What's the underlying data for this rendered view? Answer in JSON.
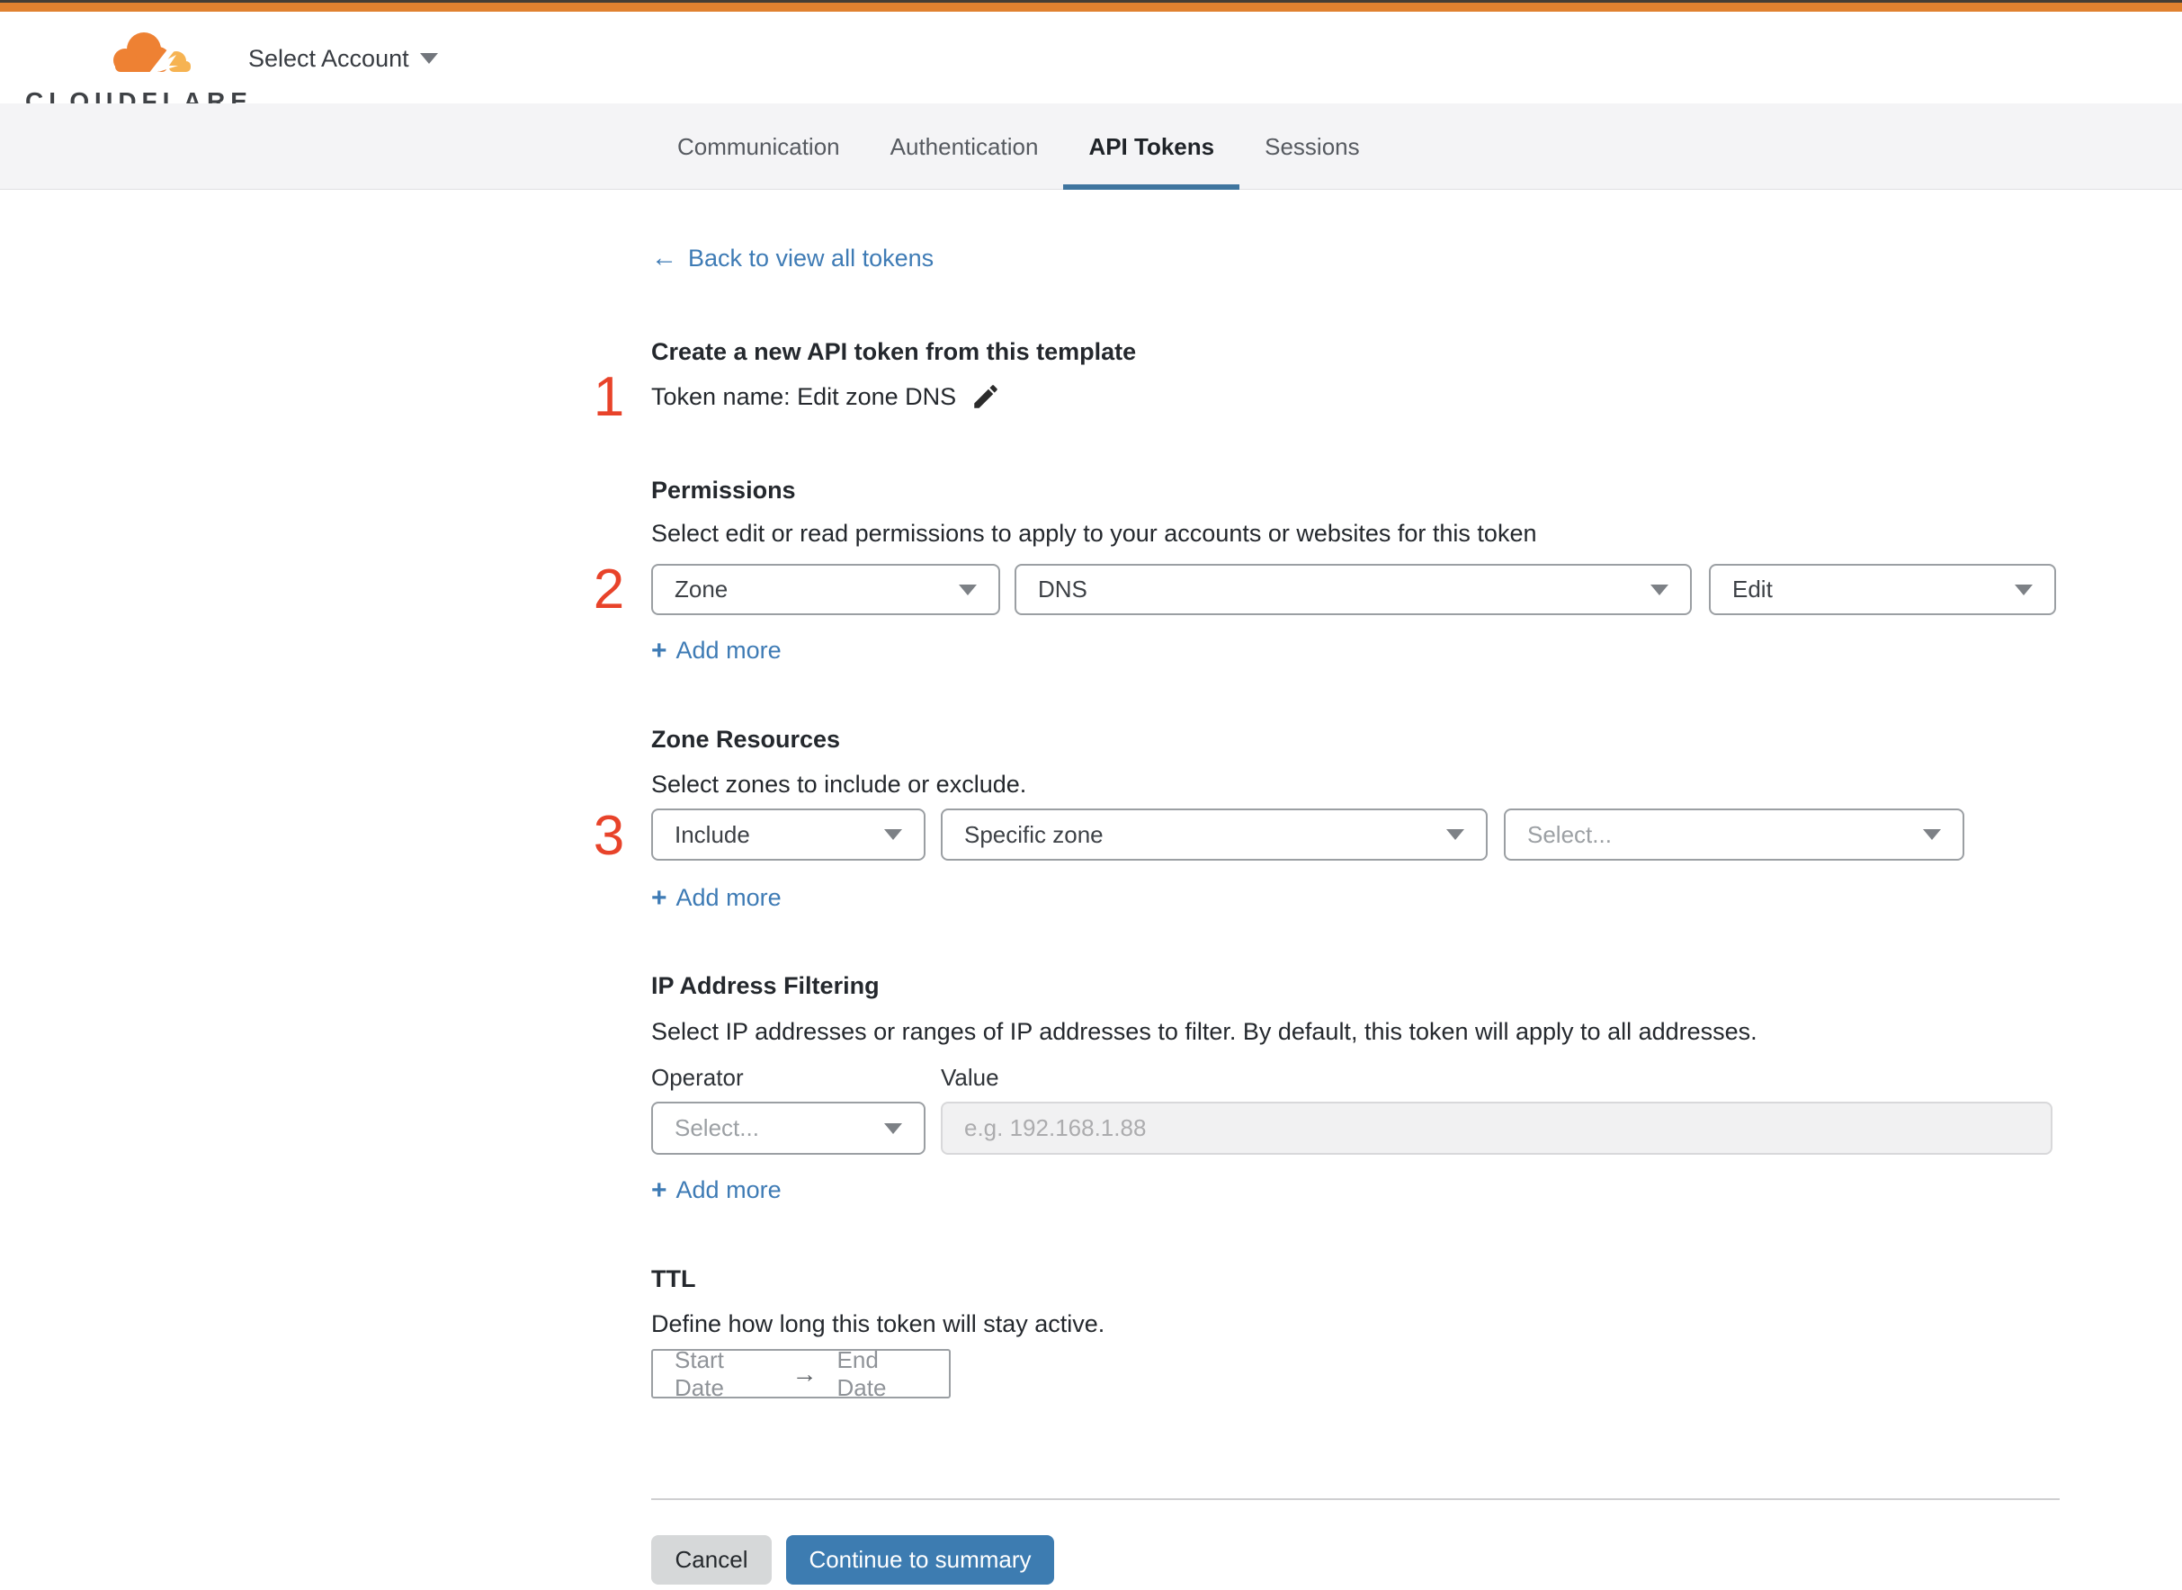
{
  "icons": {
    "plus": "+",
    "arrow_left": "←",
    "arrow_right": "→"
  },
  "topbar": {
    "brand": "CLOUDFLARE",
    "account_selector": "Select Account"
  },
  "tabs": [
    {
      "label": "Communication"
    },
    {
      "label": "Authentication"
    },
    {
      "label": "API Tokens"
    },
    {
      "label": "Sessions"
    }
  ],
  "active_tab": "API Tokens",
  "back_link": {
    "label": "Back to view all tokens"
  },
  "steps": {
    "s1": "1",
    "s2": "2",
    "s3": "3"
  },
  "token": {
    "title": "Create a new API token from this template",
    "name_line": "Token name: Edit zone DNS"
  },
  "permissions": {
    "title": "Permissions",
    "description": "Select edit or read permissions to apply to your accounts or websites for this token",
    "scope": "Zone",
    "service": "DNS",
    "access": "Edit",
    "add_more": "Add more"
  },
  "zone_resources": {
    "title": "Zone Resources",
    "description": "Select zones to include or exclude.",
    "mode": "Include",
    "type": "Specific zone",
    "zone_placeholder": "Select...",
    "add_more": "Add more"
  },
  "ip_filtering": {
    "title": "IP Address Filtering",
    "description": "Select IP addresses or ranges of IP addresses to filter. By default, this token will apply to all addresses.",
    "operator_label": "Operator",
    "value_label": "Value",
    "operator_placeholder": "Select...",
    "value_placeholder": "e.g. 192.168.1.88",
    "add_more": "Add more"
  },
  "ttl": {
    "title": "TTL",
    "description": "Define how long this token will stay active.",
    "start": "Start Date",
    "end": "End Date"
  },
  "footer": {
    "cancel": "Cancel",
    "continue": "Continue to summary"
  },
  "colors": {
    "accent_orange": "#e0812f",
    "brand_orange": "#ee8133",
    "brand_orange_light": "#f6b352",
    "link_blue": "#3e7bb5",
    "button_blue": "#3d7cb1",
    "step_red": "#e8432a",
    "tab_underline": "#3f759f"
  }
}
